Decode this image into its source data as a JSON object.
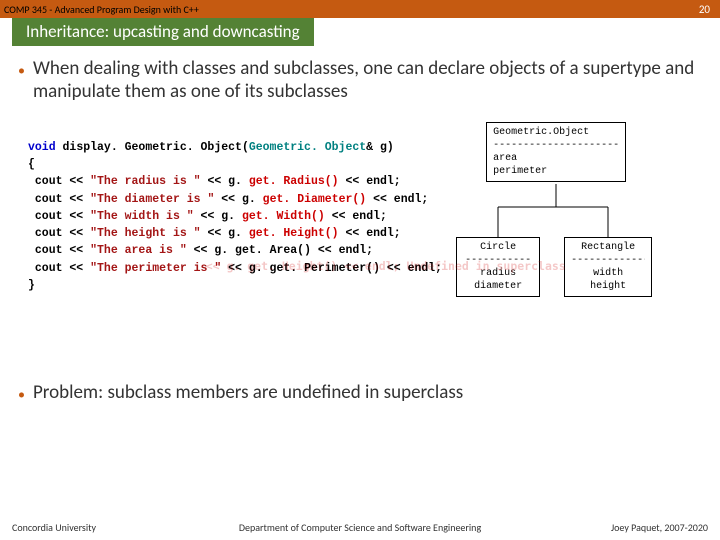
{
  "header": {
    "course": "COMP 345 - Advanced Program Design with C++",
    "page": "20"
  },
  "title": "Inheritance: upcasting and downcasting",
  "bullets": {
    "b1": "When dealing with classes and subclasses, one can declare objects of a supertype and manipulate them as one of its subclasses",
    "b2": "Problem: subclass members are undefined in superclass"
  },
  "code": {
    "l1a": "void",
    "l1b": " display. Geometric. Object(",
    "l1c": "Geometric. Object",
    "l1d": "& g)",
    "l2": "{",
    "l3a": " cout << ",
    "l3s": "\"The radius is \"",
    "l3b": " << g.",
    "l3e": " get. Radius()",
    "l3c": " << endl;",
    "l4a": " cout << ",
    "l4s": "\"The diameter is \"",
    "l4b": " << g.",
    "l4e": " get. Diameter()",
    "l4c": " << endl;",
    "l5a": " cout << ",
    "l5s": "\"The width is \"",
    "l5b": " << g.",
    "l5e": " get. Width()",
    "l5c": " << endl;",
    "l6a": " cout << ",
    "l6s": "\"The height is \"",
    "l6b": " << g.",
    "l6e": " get. Height()",
    "l6c": " << endl;",
    "l7a": " cout << ",
    "l7s": "\"The area is \"",
    "l7b": " << g. get. Area() << endl;",
    "l8a": " cout << ",
    "l8s": "\"The perimeter is \"",
    "l8b": " << g. get. Perimeter() << endl;",
    "l9": "}"
  },
  "ghost": "    << g. get. Height() << endl; Undefined in superclass",
  "uml": {
    "top_name": "Geometric.Object",
    "top_sep": "----------------------",
    "top_a1": "area",
    "top_a2": "perimeter",
    "circle_name": "Circle",
    "circle_sep": "-----------",
    "circle_a1": "radius",
    "circle_a2": "diameter",
    "rect_name": "Rectangle",
    "rect_sep": "-------------",
    "rect_a1": "width",
    "rect_a2": "height"
  },
  "footer": {
    "left": "Concordia University",
    "mid": "Department of Computer Science and Software Engineering",
    "right": "Joey Paquet, 2007-2020"
  }
}
